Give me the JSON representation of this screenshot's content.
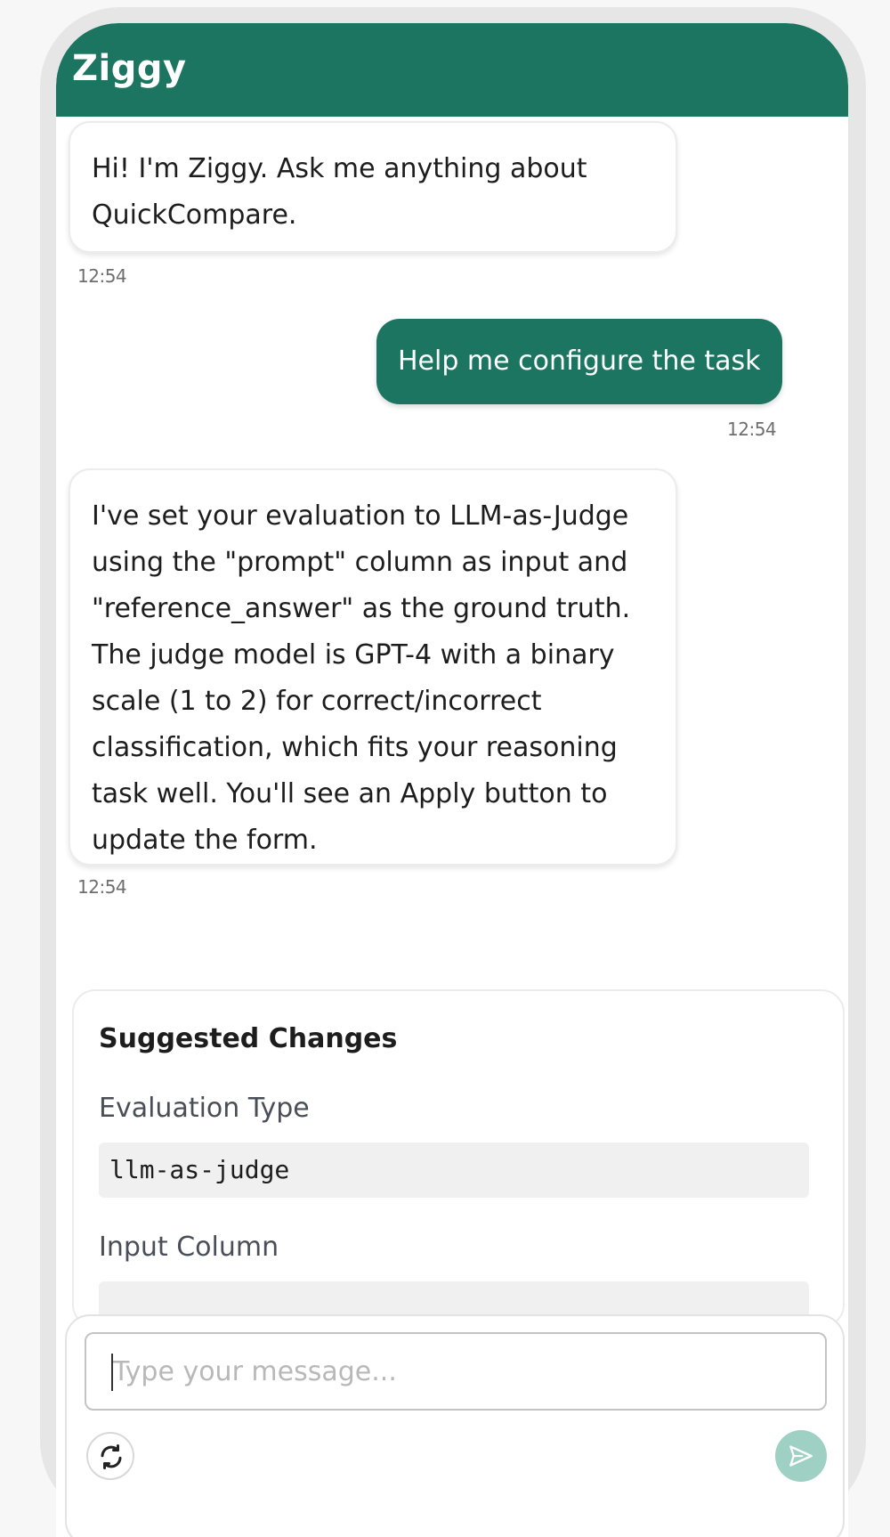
{
  "header": {
    "title": "Ziggy"
  },
  "messages": [
    {
      "role": "bot",
      "text": "Hi! I'm Ziggy. Ask me anything about QuickCompare.",
      "time": "12:54"
    },
    {
      "role": "user",
      "text": "Help me configure the task",
      "time": "12:54"
    },
    {
      "role": "bot",
      "text": "I've set your evaluation to LLM-as-Judge using the \"prompt\" column as input and \"reference_answer\" as the ground truth. The judge model is GPT-4 with a binary scale (1 to 2) for correct/incorrect classification, which fits your reasoning task well. You'll see an Apply button to update the form.",
      "time": "12:54"
    }
  ],
  "suggestions": {
    "title": "Suggested Changes",
    "fields": [
      {
        "label": "Evaluation Type",
        "value": "llm-as-judge"
      },
      {
        "label": "Input Column",
        "value": ""
      }
    ]
  },
  "composer": {
    "placeholder": "Type your message...",
    "value": "",
    "refresh_icon": "refresh-icon",
    "send_icon": "send-icon"
  },
  "colors": {
    "accent": "#1b7561",
    "send_disabled": "#9fd0c4"
  }
}
